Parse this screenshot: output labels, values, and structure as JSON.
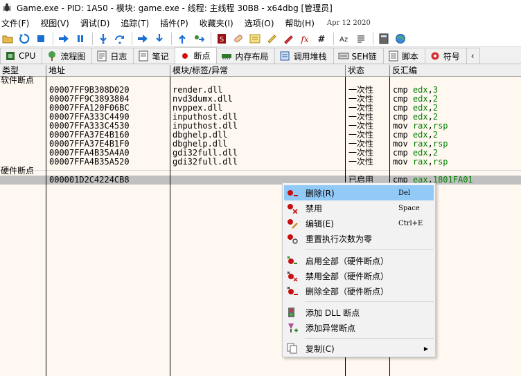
{
  "window": {
    "title": "Game.exe - PID: 1A50 - 模块: game.exe - 线程: 主线程 30B8 - x64dbg [管理员]"
  },
  "menu": {
    "items": [
      "文件(F)",
      "视图(V)",
      "调试(D)",
      "追踪(T)",
      "插件(P)",
      "收藏夹(I)",
      "选项(O)",
      "帮助(H)"
    ],
    "date": "Apr 12 2020"
  },
  "tabs": [
    {
      "label": "CPU",
      "icon": "cpu-icon"
    },
    {
      "label": "流程图",
      "icon": "graph-icon"
    },
    {
      "label": "日志",
      "icon": "log-icon"
    },
    {
      "label": "笔记",
      "icon": "notes-icon"
    },
    {
      "label": "断点",
      "icon": "breakpoint-icon"
    },
    {
      "label": "内存布局",
      "icon": "memory-icon"
    },
    {
      "label": "调用堆栈",
      "icon": "callstack-icon"
    },
    {
      "label": "SEH链",
      "icon": "seh-icon"
    },
    {
      "label": "脚本",
      "icon": "script-icon"
    },
    {
      "label": "符号",
      "icon": "symbol-icon"
    }
  ],
  "grid": {
    "headers": [
      "类型",
      "地址",
      "模块/标签/异常",
      "状态",
      "反汇编"
    ],
    "software_label": "软件断点",
    "hardware_label": "硬件断点",
    "software_rows": [
      {
        "addr": "00007FF9B308D020",
        "module": "render.dll",
        "state": "一次性",
        "op": "cmp",
        "a": "edx",
        "b": "3"
      },
      {
        "addr": "00007FF9C3893804",
        "module": "nvd3dumx.dll",
        "state": "一次性",
        "op": "cmp",
        "a": "edx",
        "b": "2"
      },
      {
        "addr": "00007FFA120F06BC",
        "module": "nvppex.dll",
        "state": "一次性",
        "op": "cmp",
        "a": "edx",
        "b": "2"
      },
      {
        "addr": "00007FFA333C4490",
        "module": "inputhost.dll",
        "state": "一次性",
        "op": "cmp",
        "a": "edx",
        "b": "2"
      },
      {
        "addr": "00007FFA333C4530",
        "module": "inputhost.dll",
        "state": "一次性",
        "op": "mov",
        "a": "rax",
        "b": "rsp"
      },
      {
        "addr": "00007FFA37E4B160",
        "module": "dbghelp.dll",
        "state": "一次性",
        "op": "cmp",
        "a": "edx",
        "b": "2"
      },
      {
        "addr": "00007FFA37E4B1F0",
        "module": "dbghelp.dll",
        "state": "一次性",
        "op": "mov",
        "a": "rax",
        "b": "rsp"
      },
      {
        "addr": "00007FFA4B35A4A0",
        "module": "gdi32full.dll",
        "state": "一次性",
        "op": "cmp",
        "a": "edx",
        "b": "2"
      },
      {
        "addr": "00007FFA4B35A520",
        "module": "gdi32full.dll",
        "state": "一次性",
        "op": "mov",
        "a": "rax",
        "b": "rsp"
      }
    ],
    "hardware_rows": [
      {
        "addr": "000001D2C4224CB8",
        "module": "",
        "state": "已启用",
        "op": "cmp",
        "a": "eax",
        "b": "1801FA01"
      }
    ]
  },
  "context_menu": {
    "items": [
      {
        "label": "删除(R)",
        "shortcut": "Del",
        "icon": "delete-breakpoint-icon"
      },
      {
        "label": "禁用",
        "shortcut": "Space",
        "icon": "disable-breakpoint-icon"
      },
      {
        "label": "编辑(E)",
        "shortcut": "Ctrl+E",
        "icon": "edit-breakpoint-icon"
      },
      {
        "label": "重置执行次数为零",
        "shortcut": "",
        "icon": "reset-hitcount-icon"
      },
      {
        "label": "启用全部（硬件断点）",
        "shortcut": "",
        "icon": "enable-all-icon"
      },
      {
        "label": "禁用全部（硬件断点）",
        "shortcut": "",
        "icon": "disable-all-icon"
      },
      {
        "label": "删除全部（硬件断点）",
        "shortcut": "",
        "icon": "delete-all-icon"
      },
      {
        "label": "添加 DLL 断点",
        "shortcut": "",
        "icon": "dll-breakpoint-icon"
      },
      {
        "label": "添加异常断点",
        "shortcut": "",
        "icon": "exception-breakpoint-icon"
      },
      {
        "label": "复制(C)",
        "shortcut": "",
        "icon": "copy-icon"
      }
    ]
  }
}
